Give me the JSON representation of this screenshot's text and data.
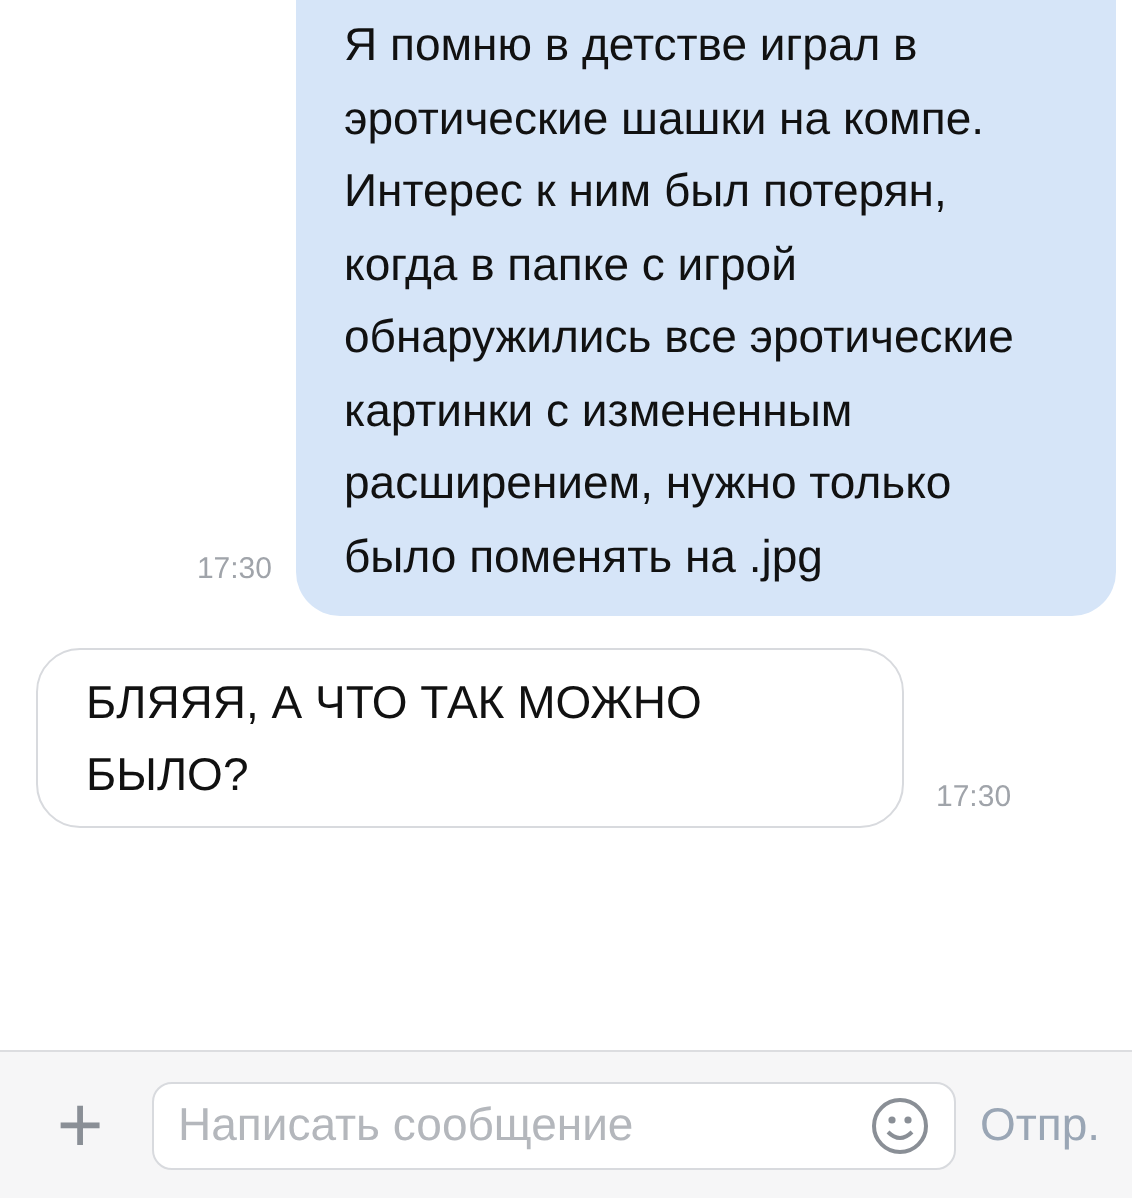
{
  "messages": [
    {
      "kind": "outgoing",
      "text": "Я помню в детстве играл в эротические шашки на компе. Интерес к ним был потерян, когда в папке с игрой обнаружились все эротические картинки с измененным расширением, нужно только было поменять на .jpg",
      "time": "17:30"
    },
    {
      "kind": "incoming",
      "text": "БЛЯЯЯ, А ЧТО ТАК МОЖНО БЫЛО?",
      "time": "17:30"
    }
  ],
  "composer": {
    "add": "+",
    "placeholder": "Написать сообщение",
    "send": "Отпр."
  }
}
